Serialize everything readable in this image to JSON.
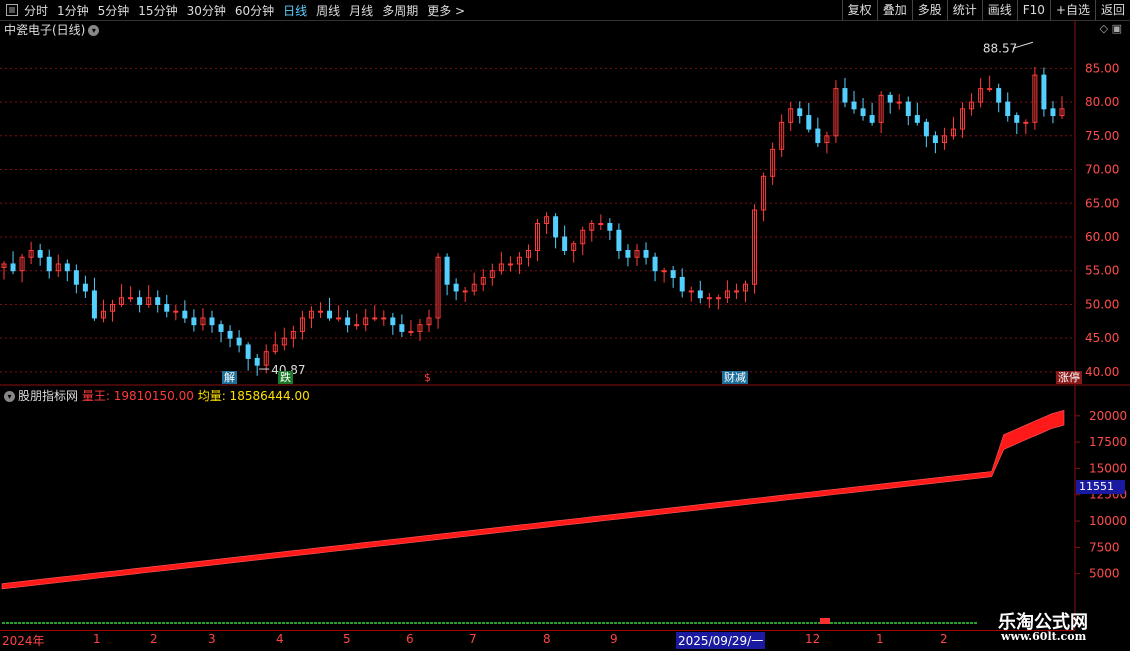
{
  "toolbar": {
    "periods": [
      "分时",
      "1分钟",
      "5分钟",
      "15分钟",
      "30分钟",
      "60分钟",
      "日线",
      "周线",
      "月线",
      "多周期",
      "更多 >"
    ],
    "active_period": "日线",
    "right": [
      "复权",
      "叠加",
      "多股",
      "统计",
      "画线",
      "F10",
      "+自选",
      "返回"
    ]
  },
  "chart_title": "中瓷电子(日线)",
  "indicator": {
    "name": "股朋指标网",
    "vol_label": "量王: 19810150.00",
    "avg_label": "均量: 18586444.00",
    "current_value": "11551"
  },
  "annotations": {
    "high": "88.57",
    "low": "40.87",
    "events": [
      "解",
      "跌",
      "$",
      "财减",
      "涨停"
    ]
  },
  "price_axis": [
    "85.00",
    "80.00",
    "75.00",
    "70.00",
    "65.00",
    "60.00",
    "55.00",
    "50.00",
    "45.00",
    "40.00"
  ],
  "vol_axis": [
    "20000",
    "17500",
    "15000",
    "12500",
    "10000",
    "7500",
    "5000"
  ],
  "date_axis": [
    "2024年",
    "1",
    "2",
    "3",
    "4",
    "5",
    "6",
    "7",
    "8",
    "9",
    "2025/09/29/一",
    "12",
    "1",
    "2"
  ],
  "watermark": {
    "line1": "乐淘公式网",
    "line2": "www.60lt.com"
  },
  "colors": {
    "up": "#ff3b3b",
    "down": "#54d0ff",
    "grid": "#7a1010",
    "volume": "#ff1a1a"
  },
  "chart_data": [
    {
      "type": "candlestick",
      "title": "中瓷电子(日线)",
      "ylim": [
        40,
        88.57
      ],
      "series": [
        {
          "values": [
            56,
            55,
            57,
            58,
            57,
            55,
            56,
            55,
            53,
            52,
            48,
            49,
            50,
            51,
            51,
            50,
            51,
            50,
            49,
            49,
            48,
            47,
            48,
            47,
            46,
            45,
            44,
            42,
            41,
            43,
            44,
            45,
            46,
            48,
            49,
            49,
            48,
            48,
            47,
            47,
            48,
            48,
            48,
            47,
            46,
            46,
            47,
            48,
            57,
            53,
            52,
            52,
            53,
            54,
            55,
            56,
            56,
            57,
            58,
            62,
            63,
            60,
            58,
            59,
            61,
            62,
            62,
            61,
            58,
            57,
            58,
            57,
            55,
            55,
            54,
            52,
            52,
            51,
            51,
            51,
            52,
            52,
            53,
            64,
            69,
            73,
            77,
            79,
            78,
            76,
            74,
            75,
            82,
            80,
            79,
            78,
            77,
            81,
            80,
            80,
            78,
            77,
            75,
            74,
            75,
            76,
            79,
            80,
            82,
            82,
            80,
            78,
            77,
            77,
            84,
            79,
            78,
            79
          ]
        }
      ]
    },
    {
      "type": "area",
      "name": "量王",
      "ylim": [
        3000,
        21000
      ],
      "series": [
        {
          "values": [
            3800,
            3930,
            4060,
            4190,
            4320,
            4450,
            4580,
            4710,
            4840,
            4970,
            5100,
            5230,
            5360,
            5490,
            5620,
            5750,
            5880,
            6010,
            6140,
            6270,
            6400,
            6530,
            6660,
            6790,
            6920,
            7050,
            7180,
            7310,
            7440,
            7570,
            7700,
            7830,
            7960,
            8090,
            8220,
            8350,
            8480,
            8610,
            8740,
            8870,
            9000,
            9130,
            9260,
            9390,
            9520,
            9650,
            9780,
            9910,
            10040,
            10170,
            10300,
            10430,
            10560,
            10690,
            10820,
            10950,
            11080,
            11210,
            11340,
            11470,
            11600,
            11730,
            11860,
            11990,
            12120,
            12250,
            12380,
            12510,
            12640,
            12770,
            12900,
            13030,
            13160,
            13290,
            13420,
            13550,
            13680,
            13810,
            13940,
            14070,
            14200,
            14330,
            14460,
            17500,
            18000,
            18500,
            19000,
            19500,
            19810
          ]
        }
      ]
    }
  ]
}
